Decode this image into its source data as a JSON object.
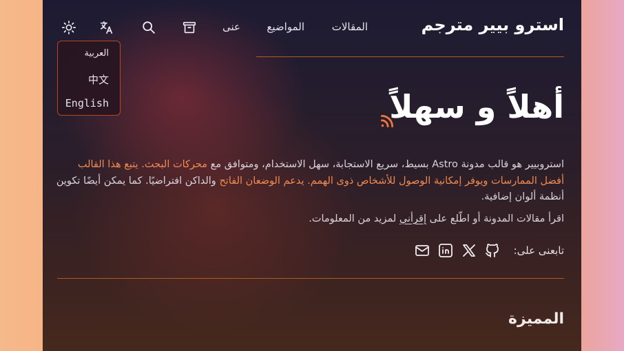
{
  "header": {
    "site_title": "استرو بيير مترجم",
    "nav": {
      "articles": "المقالات",
      "topics": "المواضيع",
      "about": "عنى"
    },
    "icons": {
      "archive": "archive-icon",
      "search": "search-icon",
      "translate": "translate-icon",
      "theme": "sun-icon"
    }
  },
  "language_menu": {
    "items": [
      {
        "label": "العربية"
      },
      {
        "label": "中文"
      },
      {
        "label": "English"
      }
    ]
  },
  "hero": {
    "title": "أهلاً و سهلاً",
    "rss_icon": "rss-icon",
    "desc_part1": "استروبيير هو قالب مدونة Astro بسيط، سريع الاستجابة، سهل الاستخدام، ومتوافق مع",
    "desc_highlight": "محركات البحث. يتبع هذا القالب أفضل الممارسات ويوفر إمكانية الوصول للأشخاص ذوى الهمم. يدعم الوضعان الفاتح",
    "desc_part2": "والداكن افتراضيًا. كما يمكن أيضًا تكوين أنظمة ألوان إضافية.",
    "read_part1": "اقرأ مقالات المدونة أو اطّلع على",
    "read_link": "إقرأني",
    "read_part2": "لمزيد من المعلومات."
  },
  "social": {
    "label": "تابعنى على:",
    "icons": [
      "github-icon",
      "x-icon",
      "linkedin-icon",
      "mail-icon"
    ]
  },
  "section": {
    "title": "المميزة"
  },
  "colors": {
    "accent": "#f08a50",
    "rule": "#b25a24",
    "panel": "#1d1b33"
  }
}
